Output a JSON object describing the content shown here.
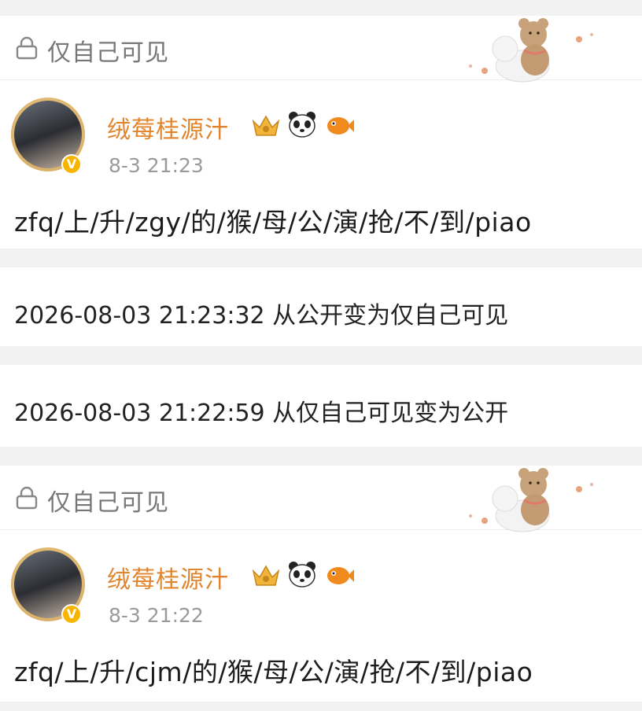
{
  "posts": [
    {
      "visibility_label": "仅自己可见",
      "username": "绒莓桂源汁",
      "time": "8-3 21:23",
      "content": "zfq/上/升/zgy/的/猴/母/公/演/抢/不/到/piao",
      "verified_mark": "V",
      "badge_icons": [
        "crown-badge-icon",
        "panda-icon",
        "fish-icon"
      ]
    },
    {
      "visibility_label": "仅自己可见",
      "username": "绒莓桂源汁",
      "time": "8-3 21:22",
      "content": "zfq/上/升/cjm/的/猴/母/公/演/抢/不/到/piao",
      "verified_mark": "V",
      "badge_icons": [
        "crown-badge-icon",
        "panda-icon",
        "fish-icon"
      ]
    }
  ],
  "logs": [
    {
      "text": "2026-08-03 21:23:32 从公开变为仅自己可见"
    },
    {
      "text": "2026-08-03 21:22:59 从仅自己可见变为公开"
    }
  ],
  "colors": {
    "username": "#e0852d",
    "background": "#f2f2f2",
    "verified": "#f7b500"
  }
}
